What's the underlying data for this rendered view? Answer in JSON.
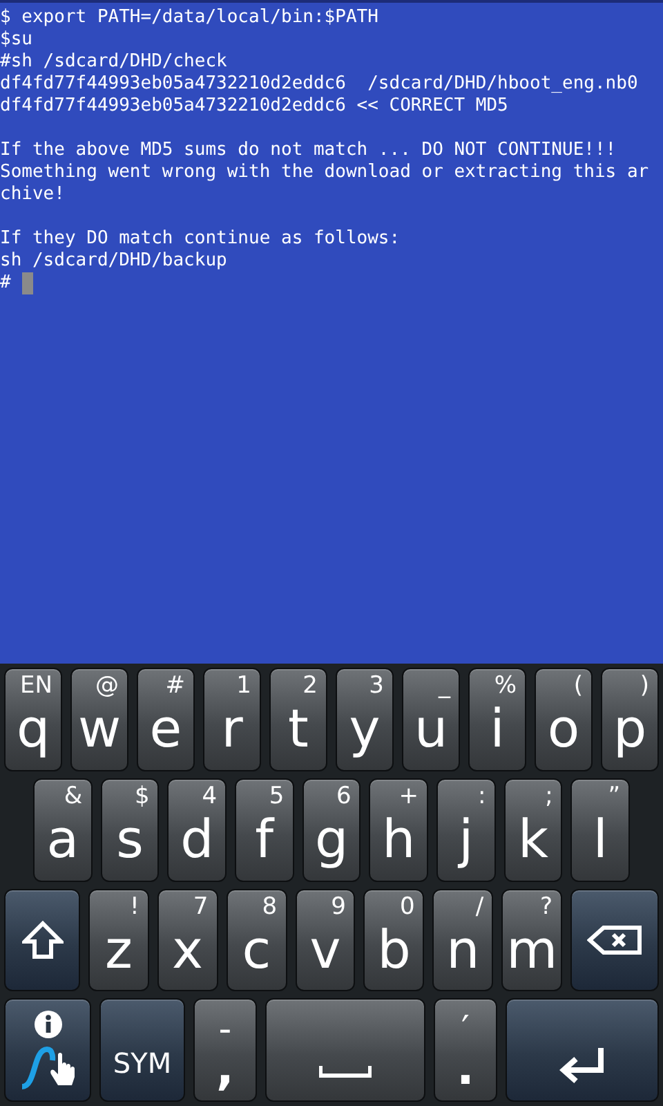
{
  "terminal": {
    "paragraphs": [
      [
        "$ export PATH=/data/local/bin:$PATH",
        "$su",
        "#sh /sdcard/DHD/check",
        "df4fd77f44993eb05a4732210d2eddc6  /sdcard/DHD/hboot_eng.nb0",
        "df4fd77f44993eb05a4732210d2eddc6 << CORRECT MD5"
      ],
      [
        "If the above MD5 sums do not match ... DO NOT CONTINUE!!!",
        "Something went wrong with the download or extracting this ar",
        "chive!"
      ],
      [
        "If they DO match continue as follows:",
        "sh /sdcard/DHD/backup",
        "# "
      ]
    ],
    "cursor": true
  },
  "keyboard": {
    "top_row": [
      {
        "kind": "letter",
        "label": "q",
        "alt": "EN"
      },
      {
        "kind": "letter",
        "label": "w",
        "alt": "@"
      },
      {
        "kind": "letter",
        "label": "e",
        "alt": "#"
      },
      {
        "kind": "letter",
        "label": "r",
        "alt": "1"
      },
      {
        "kind": "letter",
        "label": "t",
        "alt": "2"
      },
      {
        "kind": "letter",
        "label": "y",
        "alt": "3"
      },
      {
        "kind": "letter",
        "label": "u",
        "alt": "_"
      },
      {
        "kind": "letter",
        "label": "i",
        "alt": "%"
      },
      {
        "kind": "letter",
        "label": "o",
        "alt": "("
      },
      {
        "kind": "letter",
        "label": "p",
        "alt": ")"
      }
    ],
    "home_row": [
      {
        "kind": "letter",
        "label": "a",
        "alt": "&"
      },
      {
        "kind": "letter",
        "label": "s",
        "alt": "$"
      },
      {
        "kind": "letter",
        "label": "d",
        "alt": "4"
      },
      {
        "kind": "letter",
        "label": "f",
        "alt": "5"
      },
      {
        "kind": "letter",
        "label": "g",
        "alt": "6"
      },
      {
        "kind": "letter",
        "label": "h",
        "alt": "+"
      },
      {
        "kind": "letter",
        "label": "j",
        "alt": ":"
      },
      {
        "kind": "letter",
        "label": "k",
        "alt": ";"
      },
      {
        "kind": "letter",
        "label": "l",
        "alt": "”"
      }
    ],
    "lower_row": [
      {
        "kind": "shift"
      },
      {
        "kind": "letter",
        "label": "z",
        "alt": "!"
      },
      {
        "kind": "letter",
        "label": "x",
        "alt": "7"
      },
      {
        "kind": "letter",
        "label": "c",
        "alt": "8"
      },
      {
        "kind": "letter",
        "label": "v",
        "alt": "9"
      },
      {
        "kind": "letter",
        "label": "b",
        "alt": "0"
      },
      {
        "kind": "letter",
        "label": "n",
        "alt": "/"
      },
      {
        "kind": "letter",
        "label": "m",
        "alt": "?"
      },
      {
        "kind": "backspace"
      }
    ],
    "bottom_row": [
      {
        "kind": "swype"
      },
      {
        "kind": "sym",
        "label": "SYM"
      },
      {
        "kind": "punct",
        "label": ",",
        "alt": "-"
      },
      {
        "kind": "space"
      },
      {
        "kind": "punct",
        "label": ".",
        "alt": "′"
      },
      {
        "kind": "enter"
      }
    ]
  }
}
